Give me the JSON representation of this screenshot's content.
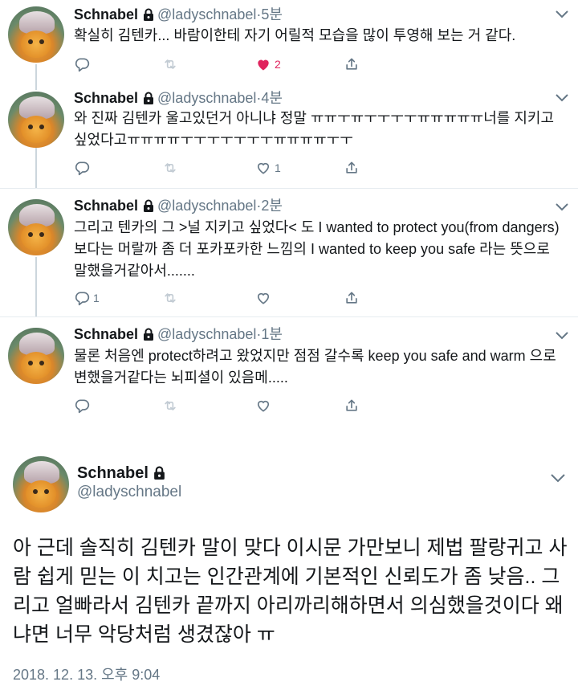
{
  "tweets": [
    {
      "name": "Schnabel",
      "handle": "@ladyschnabel",
      "dot": "·",
      "time": "5분",
      "text": "확실히 김텐카... 바람이한테 자기 어릴적 모습을 많이 투영해 보는 거 같다.",
      "reply_count": "",
      "like_count": "2",
      "liked": true
    },
    {
      "name": "Schnabel",
      "handle": "@ladyschnabel",
      "dot": "·",
      "time": "4분",
      "text": "와 진짜 김텐카 울고있던거 아니냐 정말 ㅠㅠㅜㅠㅜㅜㅜㅜㅠㅠㅠㅠㅠ너를 지키고 싶었다고ㅠㅠㅠㅠㅜㅜㅜㅜㅜㅜㅜㅠㅠㅠㅠㅜㅜ",
      "reply_count": "",
      "like_count": "1",
      "liked": false
    },
    {
      "name": "Schnabel",
      "handle": "@ladyschnabel",
      "dot": "·",
      "time": "2분",
      "text": "그리고 텐카의 그 >널 지키고 싶었다< 도 I wanted to protect you(from dangers) 보다는 머랄까 좀 더 포카포카한 느낌의 I wanted to keep you safe 라는 뜻으로 말했을거같아서.......",
      "reply_count": "1",
      "like_count": "",
      "liked": false
    },
    {
      "name": "Schnabel",
      "handle": "@ladyschnabel",
      "dot": "·",
      "time": "1분",
      "text": "물론 처음엔 protect하려고 왔었지만 점점 갈수록 keep you safe and warm 으로 변했을거같다는 뇌피셜이 있음메.....",
      "reply_count": "",
      "like_count": "",
      "liked": false
    }
  ],
  "main": {
    "name": "Schnabel",
    "handle": "@ladyschnabel",
    "text": "아 근데 솔직히 김텐카 말이 맞다 이시문 가만보니 제법 팔랑귀고 사람 쉽게 믿는 이 치고는 인간관계에 기본적인 신뢰도가 좀 낮음.. 그리고 얼빠라서 김텐카 끝까지 아리까리해하면서 의심했을것이다 왜냐면 너무 악당처럼 생겼잖아 ㅠ",
    "date": "2018. 12. 13. 오후 9:04"
  },
  "icons": {
    "reply": "reply-icon",
    "retweet": "retweet-icon",
    "like": "heart-icon",
    "share": "share-icon",
    "lock": "lock-icon",
    "more": "chevron-down-icon"
  },
  "colors": {
    "text": "#14171a",
    "muted": "#657786",
    "like": "#e0245e",
    "thread": "#ccd6dd",
    "divider": "#e6ecf0"
  }
}
